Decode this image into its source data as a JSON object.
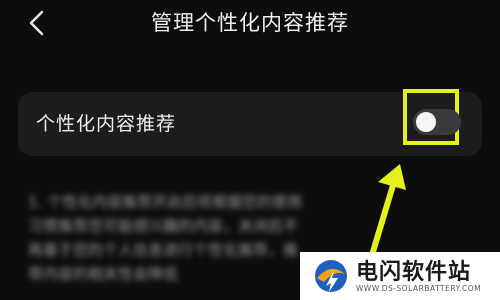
{
  "header": {
    "title": "管理个性化内容推荐",
    "back_icon": "chevron-left-icon"
  },
  "setting": {
    "label": "个性化内容推荐",
    "toggle_state": "off"
  },
  "description": {
    "lines": [
      "1. 个性化内容推荐开启后将根据您的使用",
      "习惯推荐您可能感兴趣的内容，关闭后不",
      "再基于您的个人信息进行个性化推荐，推",
      "荐内容的相关性会降低"
    ]
  },
  "annotation": {
    "highlight_color": "#e6f01b",
    "arrow_color": "#e6f01b"
  },
  "watermark": {
    "name": "电闪软件站",
    "domain": "WWW.DS-SOLARBATTERY.COM"
  }
}
